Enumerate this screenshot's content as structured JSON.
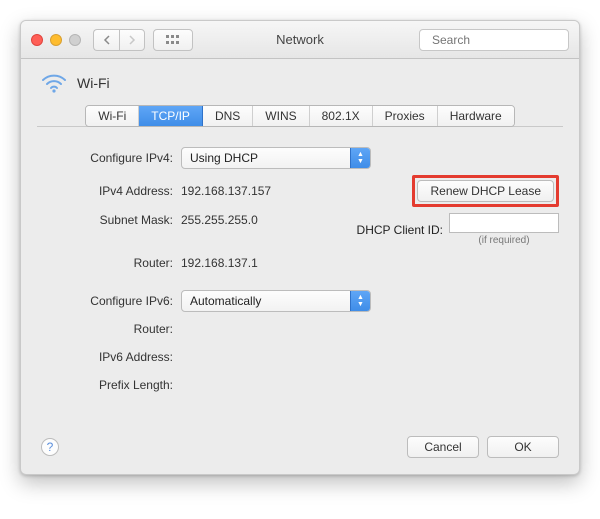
{
  "window": {
    "title": "Network"
  },
  "search": {
    "placeholder": "Search"
  },
  "page": {
    "title": "Wi-Fi"
  },
  "tabs": [
    {
      "label": "Wi-Fi",
      "active": false
    },
    {
      "label": "TCP/IP",
      "active": true
    },
    {
      "label": "DNS",
      "active": false
    },
    {
      "label": "WINS",
      "active": false
    },
    {
      "label": "802.1X",
      "active": false
    },
    {
      "label": "Proxies",
      "active": false
    },
    {
      "label": "Hardware",
      "active": false
    }
  ],
  "ipv4": {
    "configure_label": "Configure IPv4:",
    "configure_value": "Using DHCP",
    "address_label": "IPv4 Address:",
    "address_value": "192.168.137.157",
    "subnet_label": "Subnet Mask:",
    "subnet_value": "255.255.255.0",
    "router_label": "Router:",
    "router_value": "192.168.137.1",
    "renew_label": "Renew DHCP Lease",
    "client_id_label": "DHCP Client ID:",
    "client_id_value": "",
    "client_id_hint": "(if required)"
  },
  "ipv6": {
    "configure_label": "Configure IPv6:",
    "configure_value": "Automatically",
    "router_label": "Router:",
    "router_value": "",
    "address_label": "IPv6 Address:",
    "address_value": "",
    "prefix_label": "Prefix Length:",
    "prefix_value": ""
  },
  "footer": {
    "cancel_label": "Cancel",
    "ok_label": "OK"
  }
}
